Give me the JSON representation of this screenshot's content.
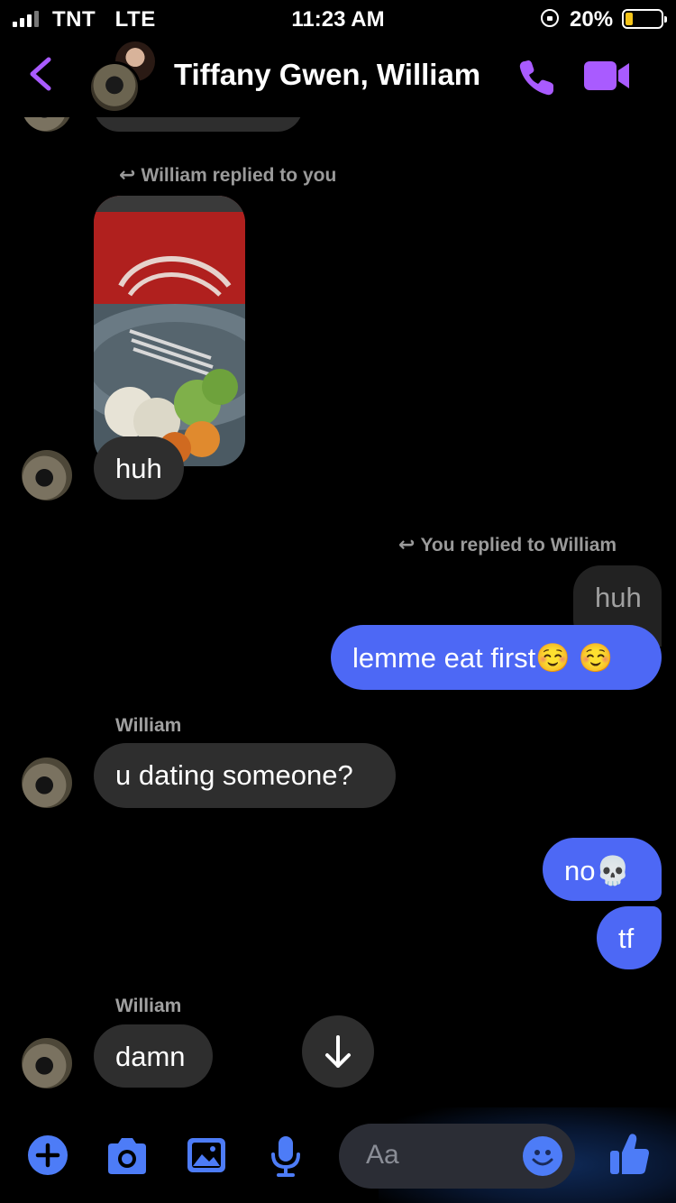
{
  "status": {
    "carrier": "TNT",
    "network": "LTE",
    "time": "11:23 AM",
    "battery_pct": "20%",
    "battery_level": 0.2
  },
  "header": {
    "title": "Tiffany Gwen, William",
    "accent": "#a95bff"
  },
  "messages": {
    "prev_bubble_text": "",
    "reply_note_1": "William replied to you",
    "william_reply": "huh",
    "reply_note_2": "You replied to William",
    "quoted_text": "huh",
    "my_reply": "lemme eat first☺️ ☺️",
    "sender_1": "William",
    "question": "u dating someone?",
    "my_no": "no💀",
    "my_tf": "tf",
    "sender_2": "William",
    "damn": "damn"
  },
  "composer": {
    "placeholder": "Aa"
  },
  "colors": {
    "outgoing_bubble": "#4d68f5",
    "incoming_bubble": "#2e2e2e",
    "icon_blue": "#4d7cf7"
  }
}
